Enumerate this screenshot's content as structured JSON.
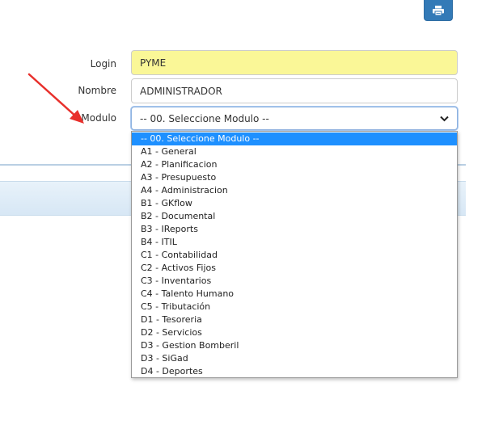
{
  "toolbar": {
    "print_icon": "printer-icon",
    "button_color": "#337ab7"
  },
  "form": {
    "login": {
      "label": "Login",
      "value": "PYME",
      "background": "#faf797"
    },
    "nombre": {
      "label": "Nombre",
      "value": "ADMINISTRADOR"
    },
    "modulo": {
      "label": "Modulo",
      "selected": "-- 00. Seleccione Modulo --",
      "icon": "chevron-down-icon"
    }
  },
  "annotation": {
    "arrow_color": "#e8302c",
    "arrow_icon": "red-arrow-icon"
  },
  "dropdown": {
    "selected_color": "#1e90ff",
    "options": [
      "-- 00. Seleccione Modulo --",
      "A1 - General",
      "A2 - Planificacion",
      "A3 - Presupuesto",
      "A4 - Administracion",
      "B1 - GKflow",
      "B2 - Documental",
      "B3 - IReports",
      "B4 - ITIL",
      "C1 - Contabilidad",
      "C2 - Activos Fijos",
      "C3 - Inventarios",
      "C4 - Talento Humano",
      "C5 - Tributación",
      "D1 - Tesoreria",
      "D2 - Servicios",
      "D3 - Gestion Bomberil",
      "D3 - SiGad",
      "D4 - Deportes"
    ]
  }
}
